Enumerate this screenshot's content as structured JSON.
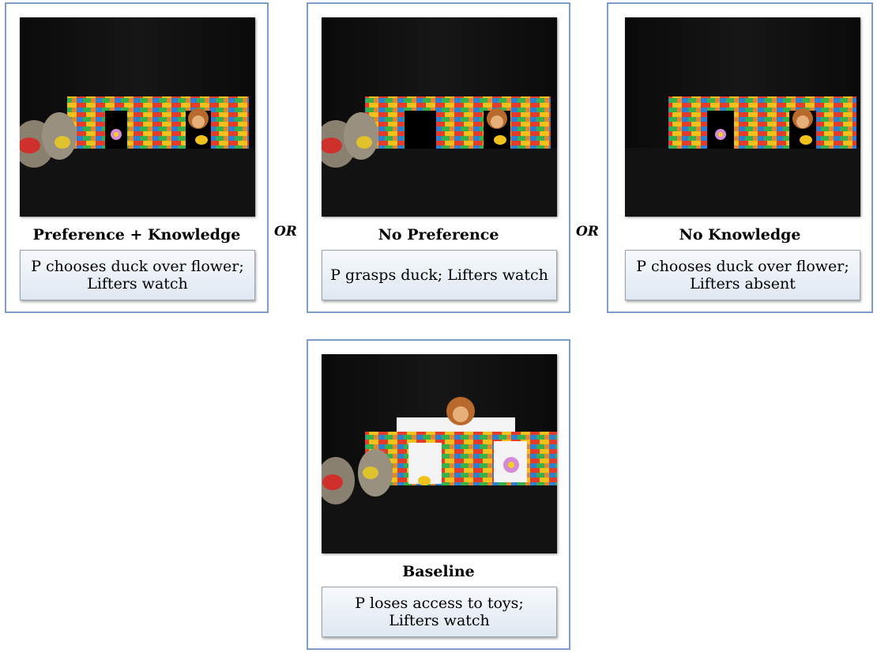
{
  "panels": [
    {
      "title": "Preference + Knowledge",
      "description": "P chooses duck over flower; Lifters watch"
    },
    {
      "title": "No Preference",
      "description": "P grasps duck; Lifters watch"
    },
    {
      "title": "No Knowledge",
      "description": "P chooses duck over flower; Lifters absent"
    },
    {
      "title": "Baseline",
      "description": "P loses access to toys; Lifters watch"
    }
  ],
  "connectors": [
    "OR",
    "OR"
  ],
  "colors": {
    "panel_border": "#7f9cc8",
    "label_box_top": "#f6f9fc",
    "label_box_bottom": "#dfe8f2"
  }
}
